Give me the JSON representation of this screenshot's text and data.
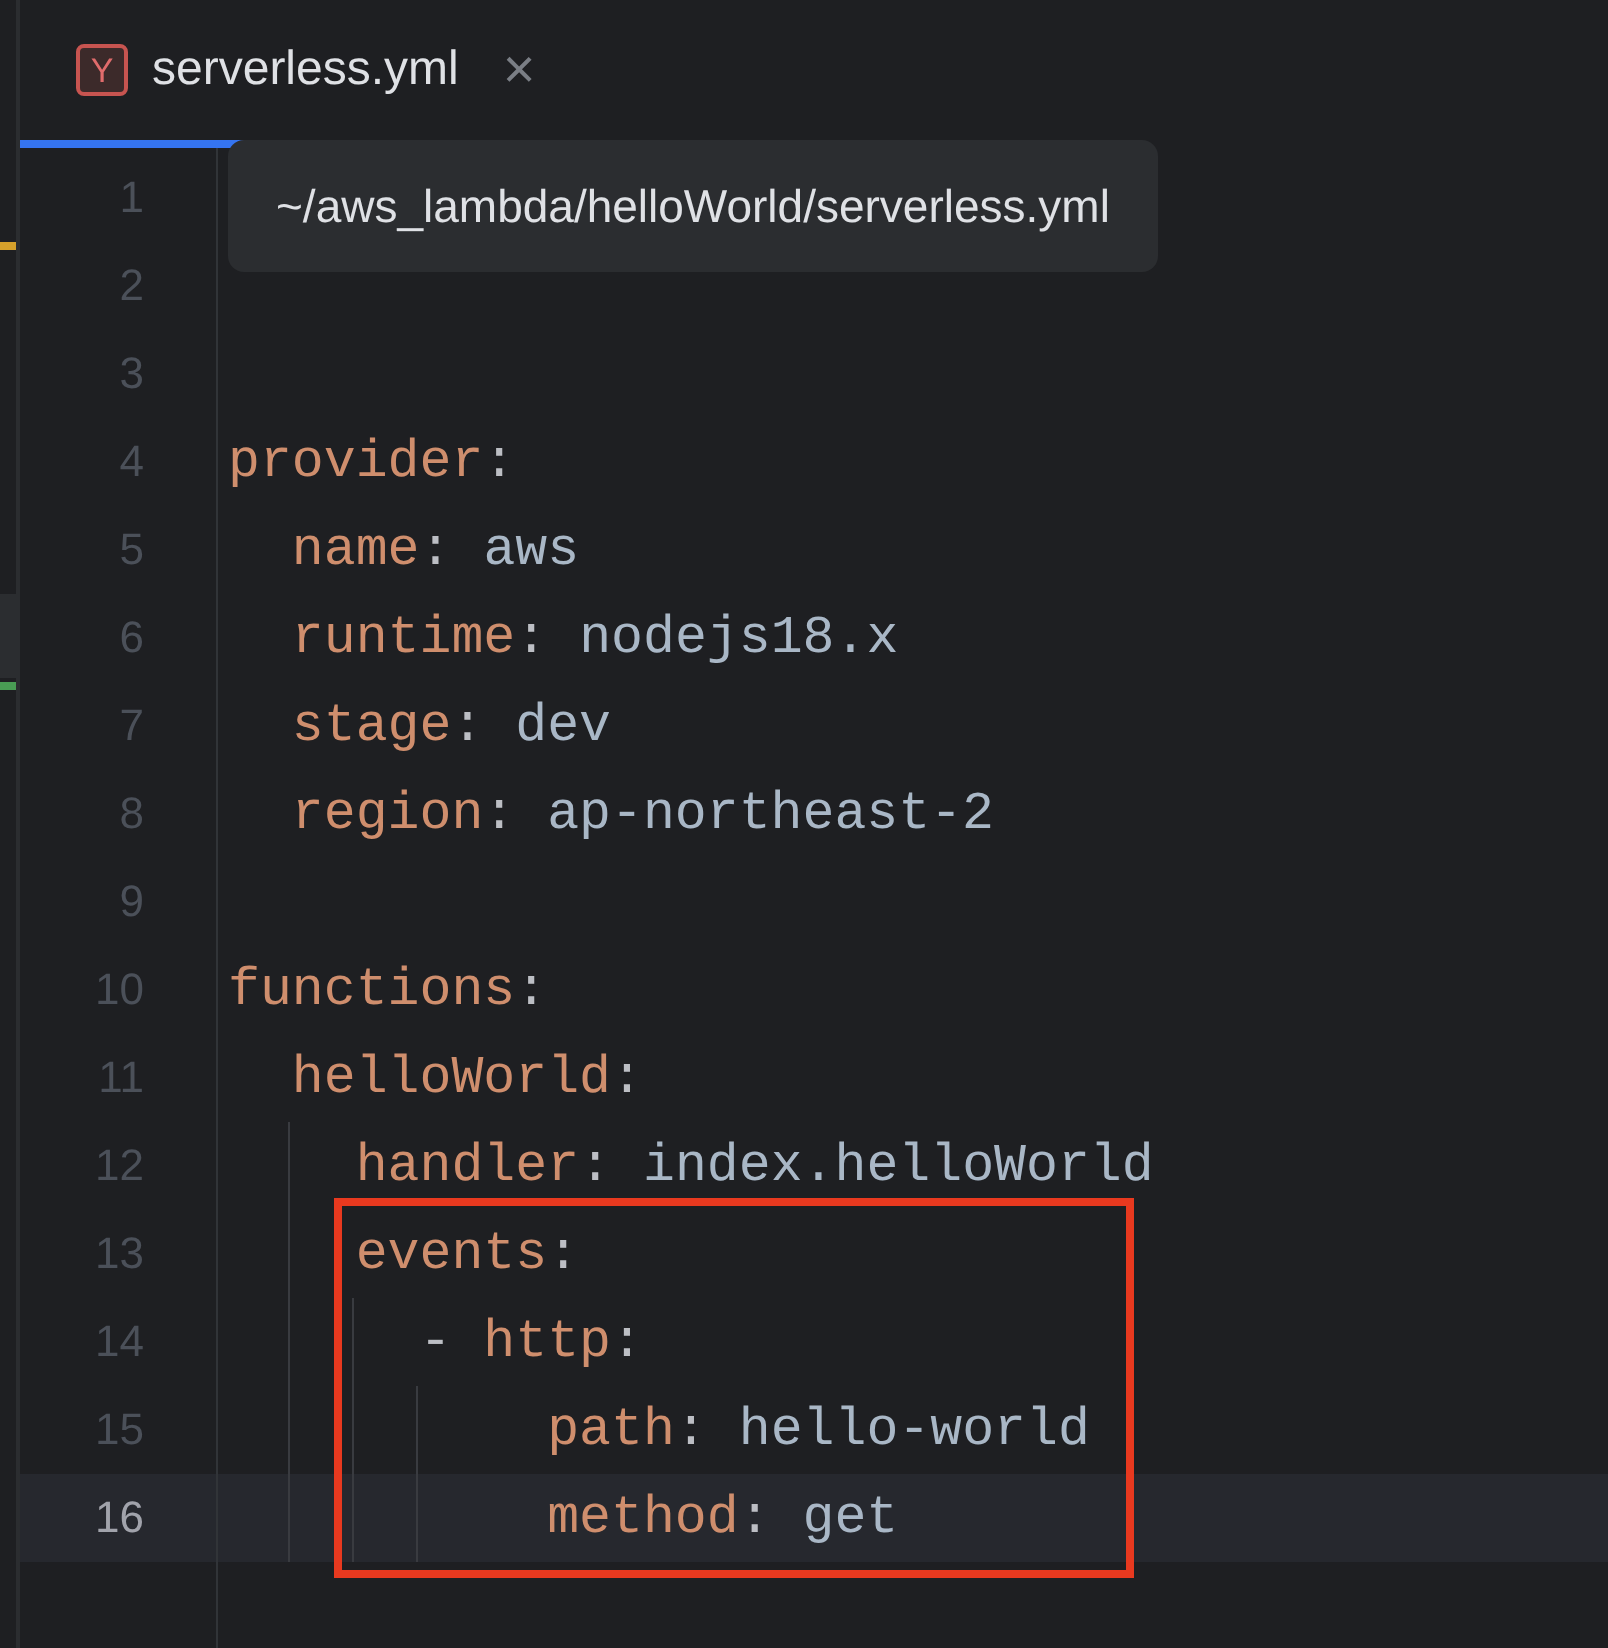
{
  "tab": {
    "icon_letter": "Y",
    "label": "serverless.yml",
    "close": "×",
    "selected": true
  },
  "tooltip": "~/aws_lambda/helloWorld/serverless.yml",
  "lines": [
    {
      "number": "1",
      "current": false,
      "boxed": false
    },
    {
      "number": "2",
      "current": false,
      "boxed": false,
      "color": "#d5a02b"
    },
    {
      "number": "3",
      "current": false,
      "boxed": false
    },
    {
      "number": "4",
      "current": false,
      "boxed": false,
      "tokens": [
        {
          "kind": "key",
          "text": "provider"
        },
        {
          "kind": "punct",
          "text": ":"
        }
      ]
    },
    {
      "number": "5",
      "current": false,
      "boxed": false,
      "tokens": [
        {
          "kind": "key",
          "text": "  name"
        },
        {
          "kind": "punct",
          "text": ": "
        },
        {
          "kind": "value",
          "text": "aws"
        }
      ]
    },
    {
      "number": "6",
      "current": false,
      "boxed": false,
      "color": "#2b2d30",
      "tokens": [
        {
          "kind": "key",
          "text": "  runtime"
        },
        {
          "kind": "punct",
          "text": ": "
        },
        {
          "kind": "value",
          "text": "nodejs18.x"
        }
      ]
    },
    {
      "number": "7",
      "current": false,
      "boxed": false,
      "color": "#499c54",
      "tokens": [
        {
          "kind": "key",
          "text": "  stage"
        },
        {
          "kind": "punct",
          "text": ": "
        },
        {
          "kind": "value",
          "text": "dev"
        }
      ]
    },
    {
      "number": "8",
      "current": false,
      "boxed": false,
      "tokens": [
        {
          "kind": "key",
          "text": "  region"
        },
        {
          "kind": "punct",
          "text": ": "
        },
        {
          "kind": "value",
          "text": "ap-northeast-2"
        }
      ]
    },
    {
      "number": "9",
      "current": false,
      "boxed": false
    },
    {
      "number": "10",
      "current": false,
      "boxed": false,
      "tokens": [
        {
          "kind": "key",
          "text": "functions"
        },
        {
          "kind": "punct",
          "text": ":"
        }
      ]
    },
    {
      "number": "11",
      "current": false,
      "boxed": false,
      "tokens": [
        {
          "kind": "key",
          "text": "  helloWorld"
        },
        {
          "kind": "punct",
          "text": ":"
        }
      ]
    },
    {
      "number": "12",
      "current": false,
      "boxed": false,
      "tokens": [
        {
          "kind": "key",
          "text": "    handler"
        },
        {
          "kind": "punct",
          "text": ": "
        },
        {
          "kind": "value",
          "text": "index.helloWorld"
        }
      ]
    },
    {
      "number": "13",
      "current": false,
      "boxed": true,
      "tokens": [
        {
          "kind": "key",
          "text": "    events"
        },
        {
          "kind": "punct",
          "text": ":"
        }
      ]
    },
    {
      "number": "14",
      "current": false,
      "boxed": true,
      "tokens": [
        {
          "kind": "punct",
          "text": "      - "
        },
        {
          "kind": "key",
          "text": "http"
        },
        {
          "kind": "punct",
          "text": ":"
        }
      ]
    },
    {
      "number": "15",
      "current": false,
      "boxed": true,
      "tokens": [
        {
          "kind": "key",
          "text": "          path"
        },
        {
          "kind": "punct",
          "text": ": "
        },
        {
          "kind": "value",
          "text": "hello-world"
        }
      ]
    },
    {
      "number": "16",
      "current": true,
      "boxed": true,
      "tokens": [
        {
          "kind": "key",
          "text": "          method"
        },
        {
          "kind": "punct",
          "text": ": "
        },
        {
          "kind": "value",
          "text": "get"
        }
      ]
    }
  ]
}
